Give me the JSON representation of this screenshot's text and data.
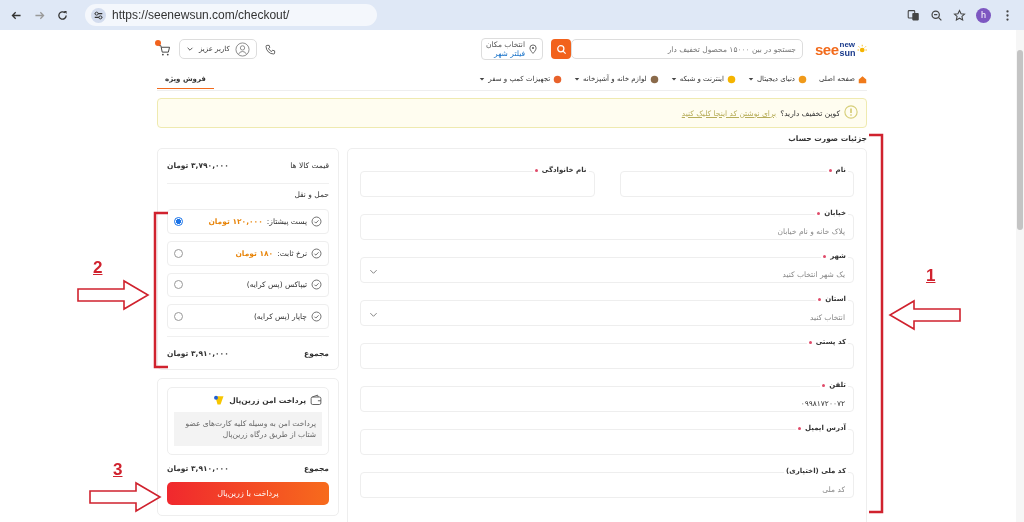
{
  "browser": {
    "url": "https://seenewsun.com/checkout/",
    "profile_initial": "h"
  },
  "header": {
    "logo": {
      "main": "see",
      "top": "new",
      "bottom": "sun"
    },
    "search": {
      "placeholder": "جستجو در بین ۱۵۰۰۰ محصول تخفیف دار"
    },
    "location": {
      "label": "انتخاب مکان",
      "value": "فیلتر شهر"
    },
    "account": {
      "label": "کاربر عزیز"
    }
  },
  "nav": {
    "items": [
      {
        "label": "صفحه اصلی",
        "has_menu": false
      },
      {
        "label": "دنیای دیجیتال",
        "has_menu": true
      },
      {
        "label": "اینترنت و شبکه",
        "has_menu": true
      },
      {
        "label": "لوازم خانه و آشپزخانه",
        "has_menu": true
      },
      {
        "label": "تجهیزات کمپ و سفر",
        "has_menu": true
      }
    ],
    "special": {
      "label": "فروش ویژه",
      "selected": true
    }
  },
  "coupon": {
    "text": "کوپن تخفیف دارید؟",
    "link": "برای نوشتن کد اینجا کلیک کنید"
  },
  "billing": {
    "title": "جزئیات صورت حساب",
    "rows": [
      [
        {
          "label": "نام",
          "required": true,
          "kind": "text"
        },
        {
          "label": "نام خانوادگی",
          "required": true,
          "kind": "text"
        }
      ],
      [
        {
          "label": "خیابان",
          "required": true,
          "kind": "text",
          "placeholder": "پلاک خانه و نام خیابان"
        }
      ],
      [
        {
          "label": "شهر",
          "required": true,
          "kind": "select",
          "placeholder": "یک شهر انتخاب کنید"
        }
      ],
      [
        {
          "label": "استان",
          "required": true,
          "kind": "select",
          "placeholder": "انتخاب کنید"
        }
      ],
      [
        {
          "label": "کد پستی",
          "required": true,
          "kind": "text"
        }
      ],
      [
        {
          "label": "تلفن",
          "required": true,
          "kind": "text",
          "value": "۰۹۹۸۱۷۲۰۰۷۲"
        }
      ],
      [
        {
          "label": "آدرس ایمیل",
          "required": true,
          "kind": "text"
        }
      ],
      [
        {
          "label": "کد ملی (اختیاری)",
          "required": false,
          "kind": "text",
          "placeholder": "کد ملی"
        }
      ]
    ]
  },
  "summary": {
    "subtotal_label": "قیمت کالا ها",
    "subtotal": "۳,۷۹۰,۰۰۰ تومان",
    "shipping_label": "حمل و نقل",
    "shipping_options": [
      {
        "name": "پست پیشتاز:",
        "price": "۱۲۰,۰۰۰ تومان",
        "selected": true
      },
      {
        "name": "نرخ ثابت:",
        "price": "۱۸۰ تومان",
        "selected": false
      },
      {
        "name": "تیپاکس (پس کرایه)",
        "selected": false
      },
      {
        "name": "چاپار (پس کرایه)",
        "selected": false
      }
    ],
    "total_label": "مجموع",
    "total": "۳,۹۱۰,۰۰۰ تومان"
  },
  "payment": {
    "method": "پرداخت امن زرین‌پال",
    "description": "پرداخت امن به وسیله کلیه کارت‌های عضو شتاب از طریق درگاه زرین‌پال",
    "total_label": "مجموع",
    "total": "۳,۹۱۰,۰۰۰ تومان",
    "button": "پرداخت با زرین‌پال"
  },
  "annotations": [
    {
      "label": "1",
      "bracket": true
    },
    {
      "label": "2",
      "bracket": true
    },
    {
      "label": "3",
      "bracket": false
    }
  ]
}
